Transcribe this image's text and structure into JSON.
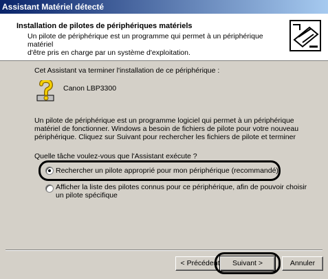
{
  "window": {
    "title": "Assistant Matériel détecté"
  },
  "header": {
    "title": "Installation de pilotes de périphériques matériels",
    "subtitle_line1": "Un pilote de périphérique est un programme qui permet à un périphérique matériel",
    "subtitle_line2": "d'être pris en charge par un système d'exploitation."
  },
  "content": {
    "intro": "Cet Assistant va terminer l'installation de ce périphérique :",
    "device_name": "Canon LBP3300",
    "description_line1": "Un pilote de périphérique est un programme logiciel qui permet à un périphérique",
    "description_line2": "matériel de fonctionner. Windows a besoin de fichiers de pilote pour votre nouveau",
    "description_line3": "périphérique. Cliquez sur Suivant pour rechercher les fichiers de pilote et terminer",
    "question": "Quelle tâche voulez-vous que l'Assistant exécute ?",
    "options": [
      {
        "label": "Rechercher un pilote approprié pour mon périphérique (recommandé)",
        "checked": true
      },
      {
        "label_line1": "Afficher la liste des pilotes connus pour ce périphérique, afin de pouvoir choisir",
        "label_line2": "un pilote spécifique",
        "checked": false
      }
    ]
  },
  "buttons": {
    "back": "< Précédent",
    "next": "Suivant >",
    "cancel": "Annuler"
  },
  "icons": {
    "wizard": "hardware-wizard-icon",
    "device": "unknown-device-question-icon"
  }
}
